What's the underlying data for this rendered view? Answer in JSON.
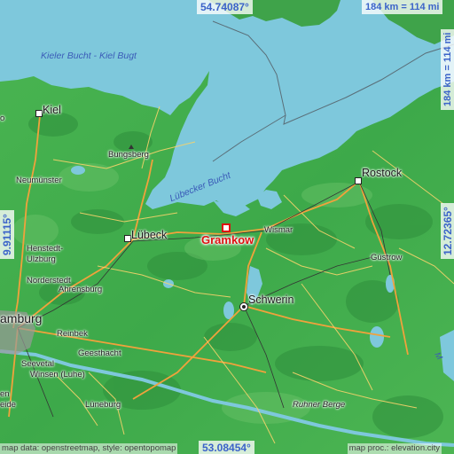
{
  "map": {
    "place": "Gramkow",
    "coords": {
      "top": "54.74087°",
      "bottom": "53.08454°",
      "left": "9.91115°",
      "right": "12.72365°"
    },
    "scale": {
      "horizontal": "184 km = 114 mi",
      "vertical": "184 km = 114 mi"
    },
    "water_labels": {
      "kiel_bay": "Kieler Bucht - Kiel Bugt",
      "lubeck_bay": "Lübecker Bucht"
    },
    "cities": {
      "kiel": "Kiel",
      "rostock": "Rostock",
      "lubeck": "Lübeck",
      "schwerin": "Schwerin",
      "hamburg": "amburg"
    },
    "towns": {
      "bungsberg": "Bungsberg",
      "neumunster": "Neumünster",
      "henstedt": "Henstedt-\nUlzburg",
      "norderstedt": "Norderstedt",
      "ahrensburg": "Ahrensburg",
      "reinbek": "Reinbek",
      "geesthacht": "Geesthacht",
      "seevetal": "Seevetal",
      "winsen": "Winsen (Luhe)",
      "luneburg": "Lüneburg",
      "wismar": "Wismar",
      "gustrow": "Güstrow",
      "ruhner": "Ruhner Berge",
      "edge_o": "o",
      "edge_en": "en",
      "edge_eide": "eide",
      "edge_m": "M"
    },
    "credits": {
      "left": "map data: openstreetmap, style: opentopomap",
      "right": "map proc.: elevation.city"
    },
    "colors": {
      "sea": "#7ec8dc",
      "land": "#3fae4b",
      "coord_text": "#3b63c9",
      "marker": "#dd1111"
    }
  }
}
